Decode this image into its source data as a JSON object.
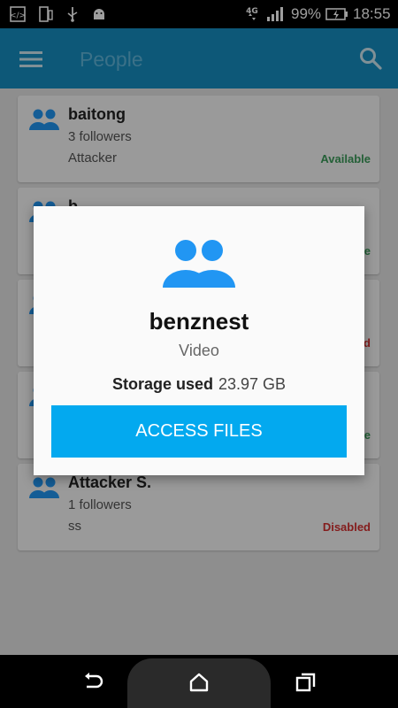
{
  "status_bar": {
    "battery": "99%",
    "time": "18:55",
    "network": "4G"
  },
  "app_bar": {
    "title": "People"
  },
  "people": [
    {
      "name": "baitong",
      "followers": "3 followers",
      "type": "Attacker",
      "status": "Available"
    },
    {
      "name": "b",
      "followers": "",
      "type": "",
      "status": "le"
    },
    {
      "name": "",
      "followers": "",
      "type": "",
      "status": "d"
    },
    {
      "name": "",
      "followers": "",
      "type": "",
      "status": "le"
    },
    {
      "name": "Attacker S.",
      "followers": "1 followers",
      "type": "ss",
      "status": "Disabled"
    }
  ],
  "dialog": {
    "name": "benznest",
    "type": "Video",
    "storage_label": "Storage used",
    "storage_value": "23.97 GB",
    "button_label": "ACCESS FILES"
  },
  "colors": {
    "primary": "#168fc2",
    "accent": "#03a9ef",
    "people_icon": "#2196f3",
    "available": "#3a9c5a",
    "disabled": "#d63030"
  }
}
